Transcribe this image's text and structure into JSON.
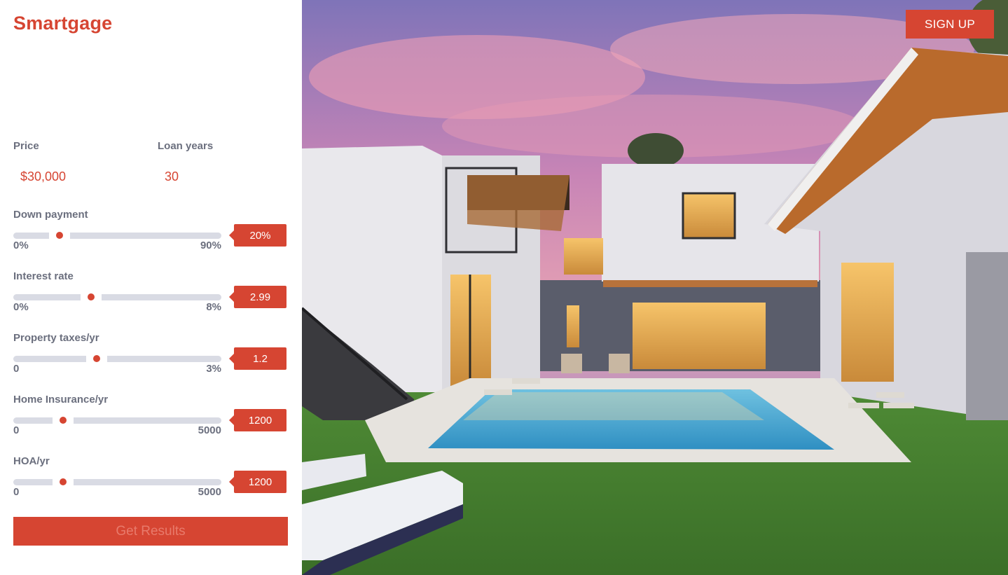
{
  "app": {
    "title": "Smartgage"
  },
  "header": {
    "signup_label": "SIGN UP"
  },
  "form": {
    "price": {
      "label": "Price",
      "value": "$30,000"
    },
    "loan_years": {
      "label": "Loan years",
      "value": "30"
    },
    "sliders": [
      {
        "label": "Down payment",
        "min": "0%",
        "max": "90%",
        "value": "20%",
        "fraction": 0.222
      },
      {
        "label": "Interest rate",
        "min": "0%",
        "max": "8%",
        "value": "2.99",
        "fraction": 0.374
      },
      {
        "label": "Property taxes/yr",
        "min": "0",
        "max": "3%",
        "value": "1.2",
        "fraction": 0.4
      },
      {
        "label": "Home Insurance/yr",
        "min": "0",
        "max": "5000",
        "value": "1200",
        "fraction": 0.24
      },
      {
        "label": "HOA/yr",
        "min": "0",
        "max": "5000",
        "value": "1200",
        "fraction": 0.24
      }
    ],
    "submit_label": "Get Results"
  },
  "colors": {
    "accent": "#d64532",
    "label": "#6b6f7e",
    "track": "#d9dbe4"
  }
}
